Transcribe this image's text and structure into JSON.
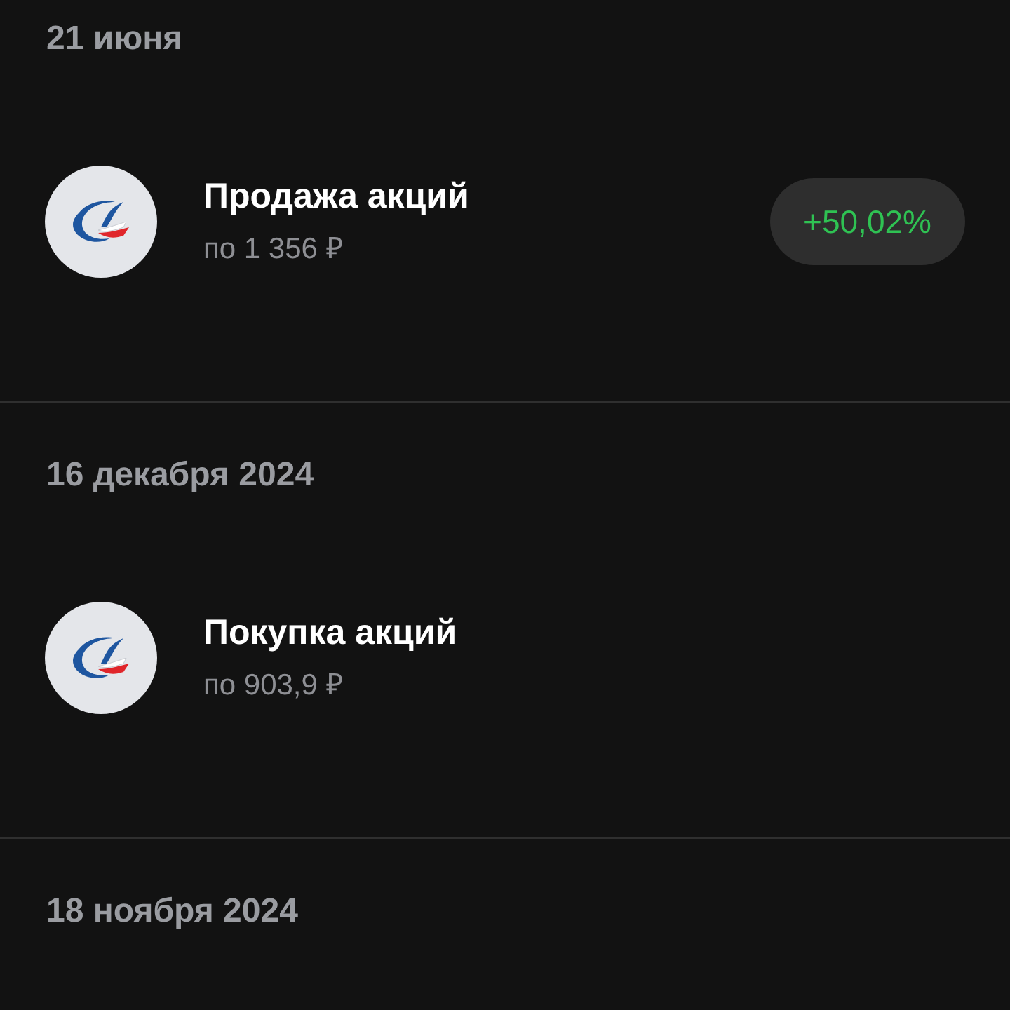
{
  "sections": [
    {
      "date": "21 июня",
      "operations": [
        {
          "title": "Продажа акций",
          "subtitle": "по 1 356 ₽",
          "change": "+50,02%"
        }
      ]
    },
    {
      "date": "16 декабря 2024",
      "operations": [
        {
          "title": "Покупка акций",
          "subtitle": "по 903,9 ₽"
        }
      ]
    },
    {
      "date": "18 ноября 2024"
    }
  ]
}
